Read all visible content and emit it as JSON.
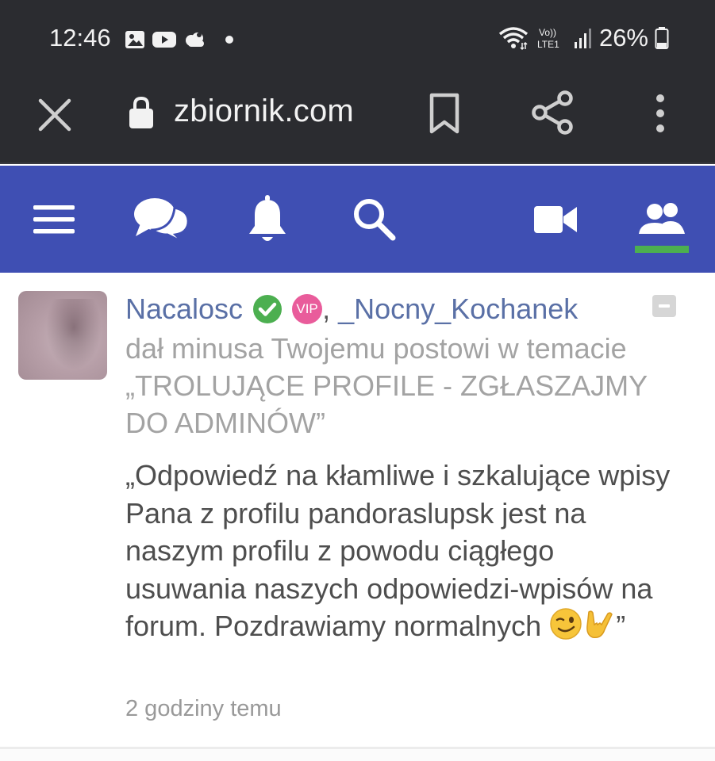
{
  "status_bar": {
    "time": "12:46",
    "left_icons": [
      "gallery-icon",
      "youtube-icon",
      "weather-cloud-icon",
      "dot-icon"
    ],
    "right_icons": [
      "wifi-icon",
      "volte-icon",
      "signal-icon",
      "battery-icon"
    ],
    "volte_label_top": "Vo))",
    "volte_label_bottom": "LTE1",
    "battery": "26%"
  },
  "browser": {
    "url": "zbiornik.com",
    "icons": [
      "close-icon",
      "lock-icon",
      "bookmark-icon",
      "share-icon",
      "more-vert-icon"
    ]
  },
  "app_nav": {
    "items": [
      "menu-icon",
      "chat-icon",
      "bell-icon",
      "search-icon",
      "video-icon",
      "people-icon"
    ],
    "active_index": 5,
    "colors": {
      "background": "#3f4fb3",
      "active_indicator": "#4caf50"
    }
  },
  "notification": {
    "user1": "Nacalosc",
    "vip_label": "VIP",
    "separator": ", ",
    "user2": "_Nocny_Kochanek",
    "action": "dał minusa Twojemu postowi w temacie „TROLUJĄCE PROFILE - ZGŁASZAJMY DO ADMINÓW”",
    "quote": "„Odpowiedź na kłamliwe i szkalujące wpisy Pana z profilu pandoraslupsk jest na naszym profilu z powodu ciągłego usuwania naszych odpowiedzi-wpisów na forum. Pozdrawiamy normalnych",
    "quote_end": "”",
    "time": "2 godziny temu",
    "colors": {
      "username": "#5a70a6",
      "verified": "#4caf50",
      "vip": "#e95c9b"
    }
  }
}
